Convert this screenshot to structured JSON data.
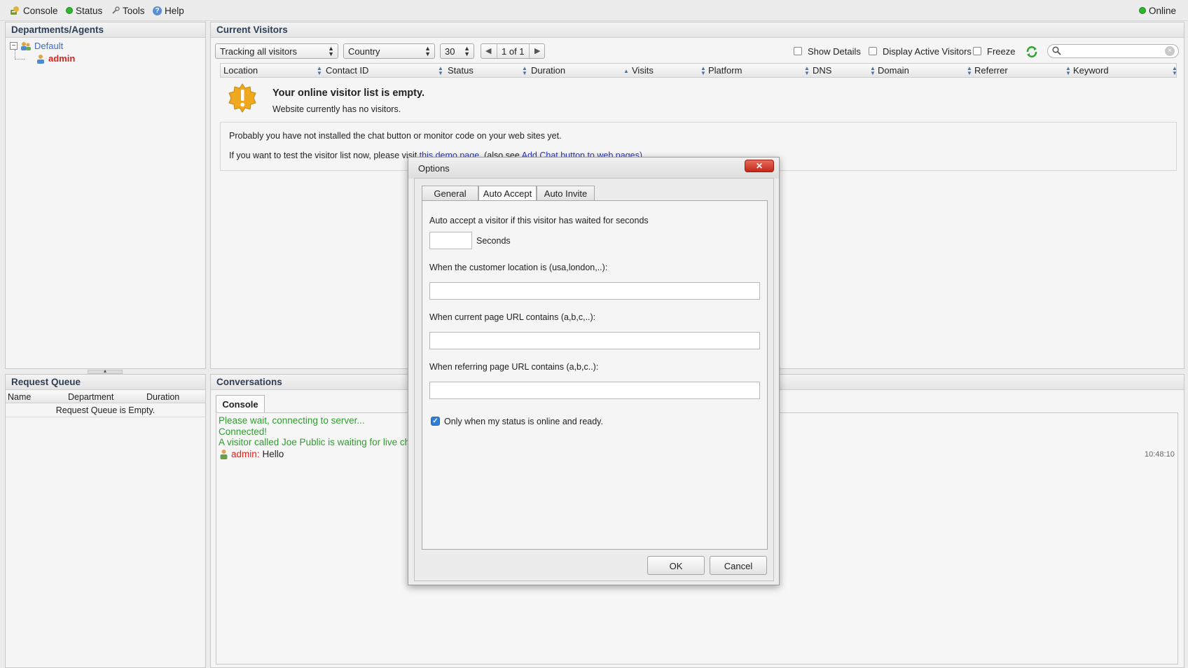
{
  "menubar": {
    "console": "Console",
    "status": "Status",
    "tools": "Tools",
    "help": "Help",
    "online_status": "Online"
  },
  "departments_panel": {
    "title": "Departments/Agents",
    "department": "Default",
    "agent": "admin"
  },
  "visitors_panel": {
    "title": "Current Visitors",
    "tracking_select": "Tracking all visitors",
    "country_select": "Country",
    "page_size_select": "30",
    "page_indicator": "1 of 1",
    "show_details": "Show Details",
    "display_active": "Display Active Visitors",
    "freeze": "Freeze",
    "columns": [
      "Location",
      "Contact ID",
      "Status",
      "Duration",
      "Visits",
      "Platform",
      "DNS",
      "Domain",
      "Referrer",
      "Keyword"
    ],
    "empty_title": "Your online visitor list is empty.",
    "empty_subtitle": "Website currently has no visitors.",
    "install_hint": "Probably you have not installed the chat button or monitor code on your web sites yet.",
    "test_hint_prefix": "If you want to test the visitor list now, please visit",
    "demo_link": "this demo page.",
    "also_see": "(also see",
    "add_chat_link": "Add Chat button to web pages)"
  },
  "request_queue": {
    "title": "Request Queue",
    "columns": [
      "Name",
      "Department",
      "Duration"
    ],
    "empty": "Request Queue is Empty."
  },
  "conversations": {
    "title": "Conversations",
    "tab": "Console",
    "lines": [
      "Please wait, connecting to server...",
      "Connected!",
      "A visitor called Joe Public is waiting for live ch"
    ],
    "sender": "admin:",
    "message": "Hello",
    "timestamp": "10:48:10"
  },
  "dialog": {
    "title": "Options",
    "tabs": [
      "General",
      "Auto Accept",
      "Auto Invite"
    ],
    "active_tab": "Auto Accept",
    "wait_label": "Auto accept a visitor if this visitor has waited for seconds",
    "seconds_value": "",
    "seconds_label": "Seconds",
    "location_label": "When the customer location is (usa,london,..):",
    "location_value": "",
    "page_url_label": "When current page URL contains (a,b,c,..):",
    "page_url_value": "",
    "referrer_label": "When referring page URL contains (a,b,c..):",
    "referrer_value": "",
    "online_only_label": "Only when my status is online and ready.",
    "online_only_checked": true,
    "ok": "OK",
    "cancel": "Cancel"
  },
  "colors": {
    "panel_title": "#2d3f55",
    "agent_red": "#e0221b",
    "dept_blue": "#3b6bc4",
    "log_green": "#2e9d2e",
    "link_blue": "#2434c8",
    "checkbox_blue": "#2f7fd8"
  }
}
